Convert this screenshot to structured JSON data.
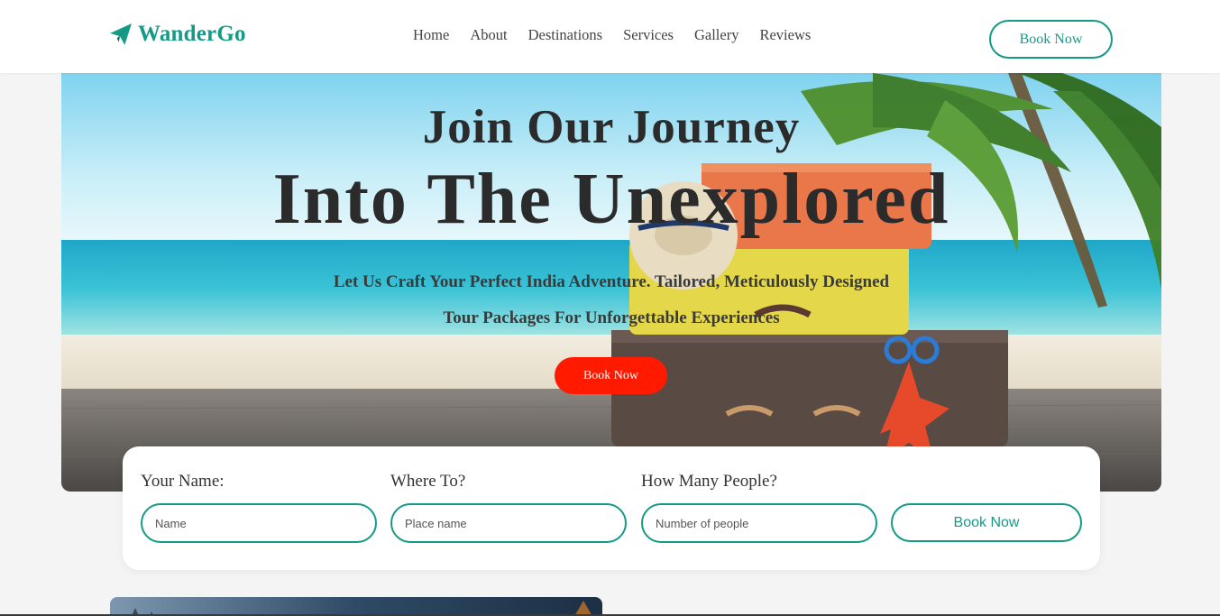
{
  "nav": {
    "logo_text": "WanderGo",
    "logo_icon": "paper-plane-icon",
    "links": [
      "Home",
      "About",
      "Destinations",
      "Services",
      "Gallery",
      "Reviews"
    ],
    "book_label": "Book Now"
  },
  "hero": {
    "title_line1": "Join Our Journey",
    "title_line2": "Into The Unexplored",
    "subtitle_line1": "Let Us Craft Your Perfect India Adventure. Tailored, Meticulously Designed",
    "subtitle_line2": "Tour Packages For Unforgettable Experiences",
    "button_label": "Book Now"
  },
  "booking": {
    "name_label": "Your Name:",
    "name_placeholder": "Name",
    "where_label": "Where To?",
    "where_placeholder": "Place name",
    "people_label": "How Many People?",
    "people_placeholder": "Number of people",
    "submit_label": "Book Now"
  },
  "colors": {
    "brand": "#159a88",
    "accent": "#ff1a00",
    "background": "#f4f4f4"
  }
}
